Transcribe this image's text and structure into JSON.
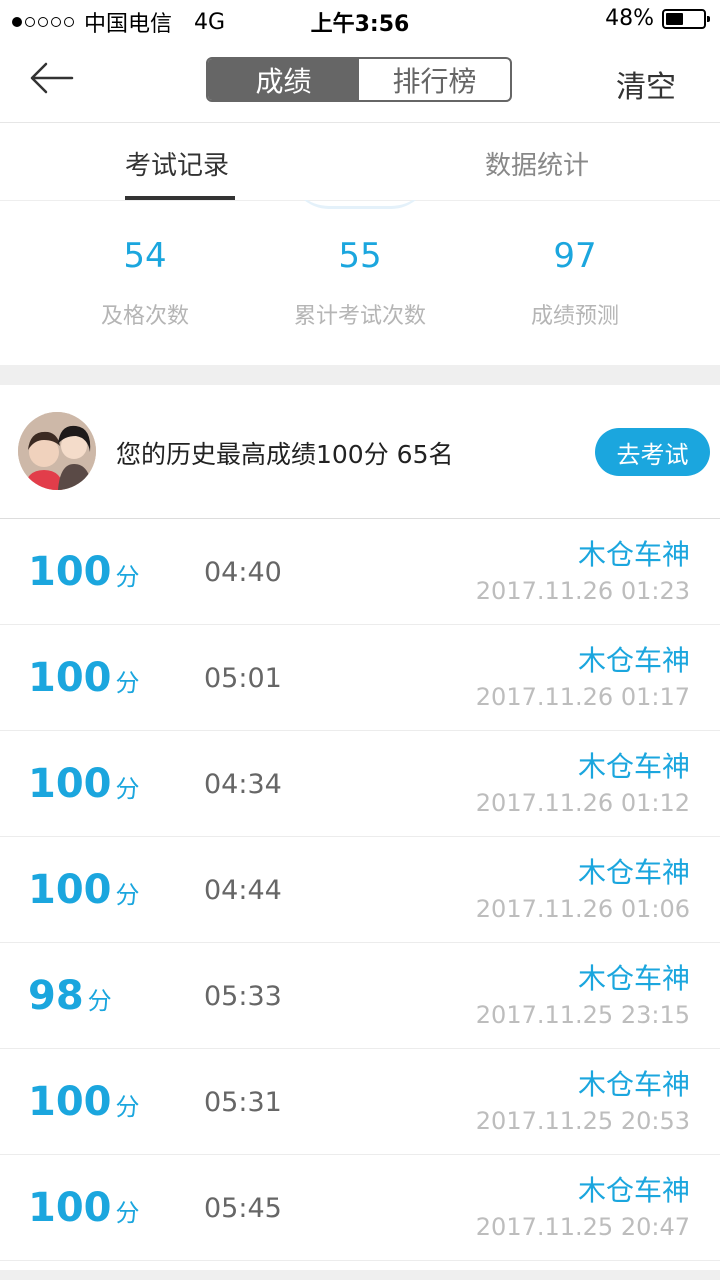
{
  "status_bar": {
    "carrier": "中国电信",
    "network": "4G",
    "time": "上午3:56",
    "battery": "48%",
    "battery_level": 0.48
  },
  "nav": {
    "segments": [
      "成绩",
      "排行榜"
    ],
    "active_segment": 0,
    "clear_label": "清空"
  },
  "tabs": [
    "考试记录",
    "数据统计"
  ],
  "stats": [
    {
      "value": "54",
      "label": "及格次数"
    },
    {
      "value": "55",
      "label": "累计考试次数"
    },
    {
      "value": "97",
      "label": "成绩预测"
    }
  ],
  "best": {
    "text": "您的历史最高成绩100分  65名",
    "button": "去考试"
  },
  "score_unit": "分",
  "colors": {
    "accent": "#1ba6de",
    "segment_active": "#666666"
  },
  "records": [
    {
      "score": "100",
      "duration": "04:40",
      "name": "木仓车神",
      "date": "2017.11.26 01:23"
    },
    {
      "score": "100",
      "duration": "05:01",
      "name": "木仓车神",
      "date": "2017.11.26 01:17"
    },
    {
      "score": "100",
      "duration": "04:34",
      "name": "木仓车神",
      "date": "2017.11.26 01:12"
    },
    {
      "score": "100",
      "duration": "04:44",
      "name": "木仓车神",
      "date": "2017.11.26 01:06"
    },
    {
      "score": "98",
      "duration": "05:33",
      "name": "木仓车神",
      "date": "2017.11.25 23:15"
    },
    {
      "score": "100",
      "duration": "05:31",
      "name": "木仓车神",
      "date": "2017.11.25 20:53"
    },
    {
      "score": "100",
      "duration": "05:45",
      "name": "木仓车神",
      "date": "2017.11.25 20:47"
    }
  ]
}
